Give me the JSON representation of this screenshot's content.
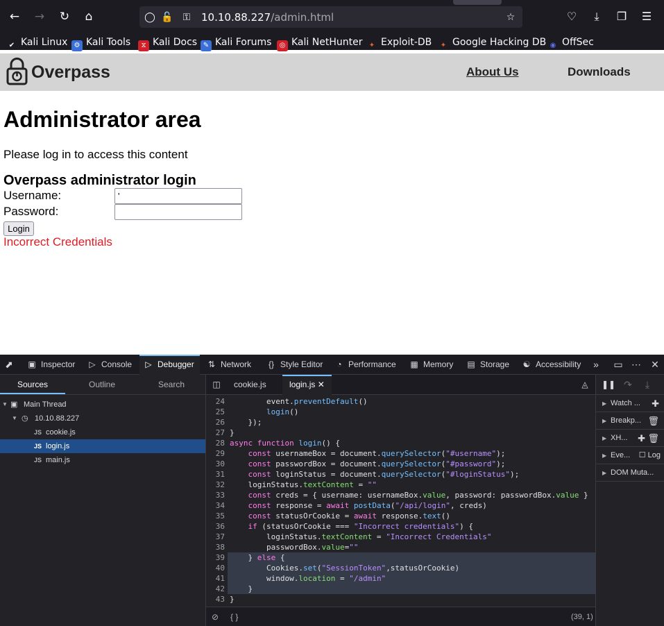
{
  "browser": {
    "url_host": "10.10.88.227",
    "url_path": "/admin.html"
  },
  "bookmarks": [
    {
      "label": "Kali Linux",
      "icon": "kali-dragon-icon"
    },
    {
      "label": "Kali Tools",
      "icon": "kali-tools-icon",
      "color": "#c03ec0"
    },
    {
      "label": "Kali Docs",
      "icon": "kali-docs-icon",
      "color": "#d0212a"
    },
    {
      "label": "Kali Forums",
      "icon": "kali-forums-icon",
      "color": "#3b6fd8"
    },
    {
      "label": "Kali NetHunter",
      "icon": "nethunter-icon",
      "color": "#d0212a"
    },
    {
      "label": "Exploit-DB",
      "icon": "exploit-db-icon",
      "color": "#e0632a"
    },
    {
      "label": "Google Hacking DB",
      "icon": "ghdb-icon",
      "color": "#e0632a"
    },
    {
      "label": "OffSec",
      "icon": "offsec-icon",
      "color": "#5b6ee8"
    }
  ],
  "site": {
    "name": "Overpass",
    "nav": [
      "About Us",
      "Downloads"
    ]
  },
  "page": {
    "title": "Administrator area",
    "intro": "Please log in to access this content",
    "login_heading": "Overpass administrator login",
    "username_label": "Username:",
    "username_value": "'",
    "password_label": "Password:",
    "password_value": "",
    "login_button": "Login",
    "status": "Incorrect Credentials"
  },
  "devtools": {
    "tabs": [
      "Inspector",
      "Console",
      "Debugger",
      "Network",
      "Style Editor",
      "Performance",
      "Memory",
      "Storage",
      "Accessibility"
    ],
    "active_tab": "Debugger",
    "sources_tabs": [
      "Sources",
      "Outline",
      "Search"
    ],
    "tree": {
      "thread": "Main Thread",
      "host": "10.10.88.227",
      "files": [
        "cookie.js",
        "login.js",
        "main.js"
      ],
      "selected": "login.js",
      "js_badge": "JS"
    },
    "editor_tabs": [
      "cookie.js",
      "login.js"
    ],
    "active_editor_tab": "login.js",
    "footer_format": "{ }",
    "cursor_position": "(39, 1)",
    "right_panels": [
      "Watch ...",
      "Breakp...",
      "XH...",
      "Eve...",
      "DOM Muta..."
    ],
    "events_log_label": "Log",
    "code_first_line": 24,
    "code_lines": [
      "        event.preventDefault()",
      "        login()",
      "    });",
      "}",
      "async function login() {",
      "    const usernameBox = document.querySelector(\"#username\");",
      "    const passwordBox = document.querySelector(\"#password\");",
      "    const loginStatus = document.querySelector(\"#loginStatus\");",
      "    loginStatus.textContent = \"\"",
      "    const creds = { username: usernameBox.value, password: passwordBox.value }",
      "    const response = await postData(\"/api/login\", creds)",
      "    const statusOrCookie = await response.text()",
      "    if (statusOrCookie === \"Incorrect credentials\") {",
      "        loginStatus.textContent = \"Incorrect Credentials\"",
      "        passwordBox.value=\"\"",
      "    } else {",
      "        Cookies.set(\"SessionToken\",statusOrCookie)",
      "        window.location = \"/admin\"",
      "    }",
      "}"
    ],
    "highlighted_lines": [
      39,
      40,
      41,
      42
    ]
  }
}
